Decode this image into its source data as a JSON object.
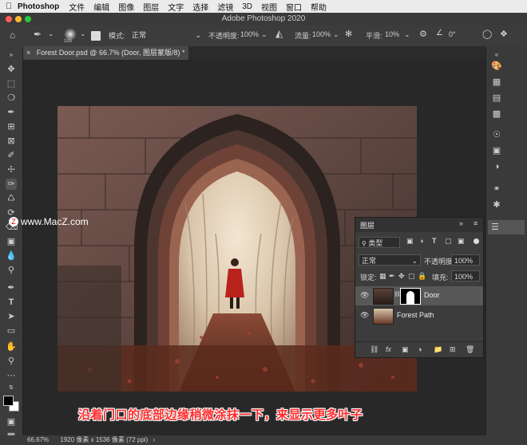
{
  "menubar": {
    "app": "Photoshop",
    "items": [
      "文件",
      "编辑",
      "图像",
      "图层",
      "文字",
      "选择",
      "滤镜",
      "3D",
      "视图",
      "窗口",
      "帮助"
    ]
  },
  "window": {
    "title": "Adobe Photoshop 2020"
  },
  "options": {
    "brush_size": "100",
    "mode_label": "模式:",
    "mode_value": "正常",
    "opacity_label": "不透明度:",
    "opacity_value": "100%",
    "flow_label": "流量:",
    "flow_value": "100%",
    "smoothing_label": "平滑:",
    "smoothing_value": "10%",
    "angle_value": "0°"
  },
  "document_tab": {
    "label": "Forest Door.psd @ 66.7% (Door, 图层蒙版/8) *"
  },
  "layers_panel": {
    "title": "图层",
    "filter_label": "类型",
    "blend_mode": "正常",
    "opacity_label": "不透明度:",
    "opacity_value": "100%",
    "lock_label": "锁定:",
    "fill_label": "填充:",
    "fill_value": "100%",
    "layers": [
      {
        "name": "Door"
      },
      {
        "name": "Forest Path"
      }
    ]
  },
  "status": {
    "zoom": "66.67%",
    "doc_info": "1920 像素 x 1536 像素 (72 ppi)"
  },
  "overlay": {
    "watermark": "www.MacZ.com",
    "subtitle": "沿着门口的底部边缘稍微涂抹一下，来显示更多叶子"
  },
  "colors": {
    "subtitle": "#ff2b2b",
    "panel_bg": "#3c3c3c",
    "canvas_bg": "#282828"
  }
}
